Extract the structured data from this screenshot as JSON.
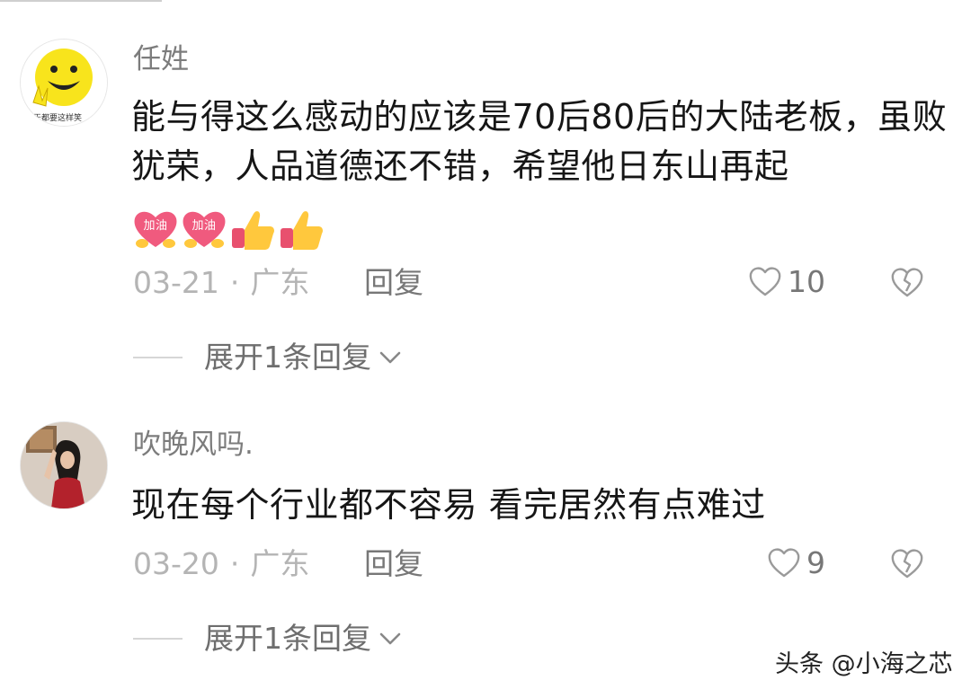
{
  "comments": [
    {
      "username": "任姓",
      "avatar_caption": "天都要这样笑",
      "content": "能与得这么感动的应该是70后80后的大陆老板，虽败犹荣，人品道德还不错，希望他日东山再起",
      "emojis": [
        {
          "icon": "heart-jiayou-emoji",
          "text": "加油"
        },
        {
          "icon": "heart-jiayou-emoji",
          "text": "加油"
        },
        {
          "icon": "thumbs-up-emoji"
        },
        {
          "icon": "thumbs-up-emoji"
        }
      ],
      "date": "03-21",
      "location": "广东",
      "reply_label": "回复",
      "likes": "10",
      "expand_label": "展开1条回复"
    },
    {
      "username": "吹晚风吗.",
      "content": "现在每个行业都不容易 看完居然有点难过",
      "date": "03-20",
      "location": "广东",
      "reply_label": "回复",
      "likes": "9",
      "expand_label": "展开1条回复"
    }
  ],
  "separator": "·",
  "watermark": "头条 @小海之芯",
  "colors": {
    "text_primary": "#161616",
    "text_secondary": "#7c7c7c",
    "text_meta": "#b4b4b4",
    "heart_pink": "#f05a7e",
    "thumb_yellow": "#ffc83d"
  }
}
